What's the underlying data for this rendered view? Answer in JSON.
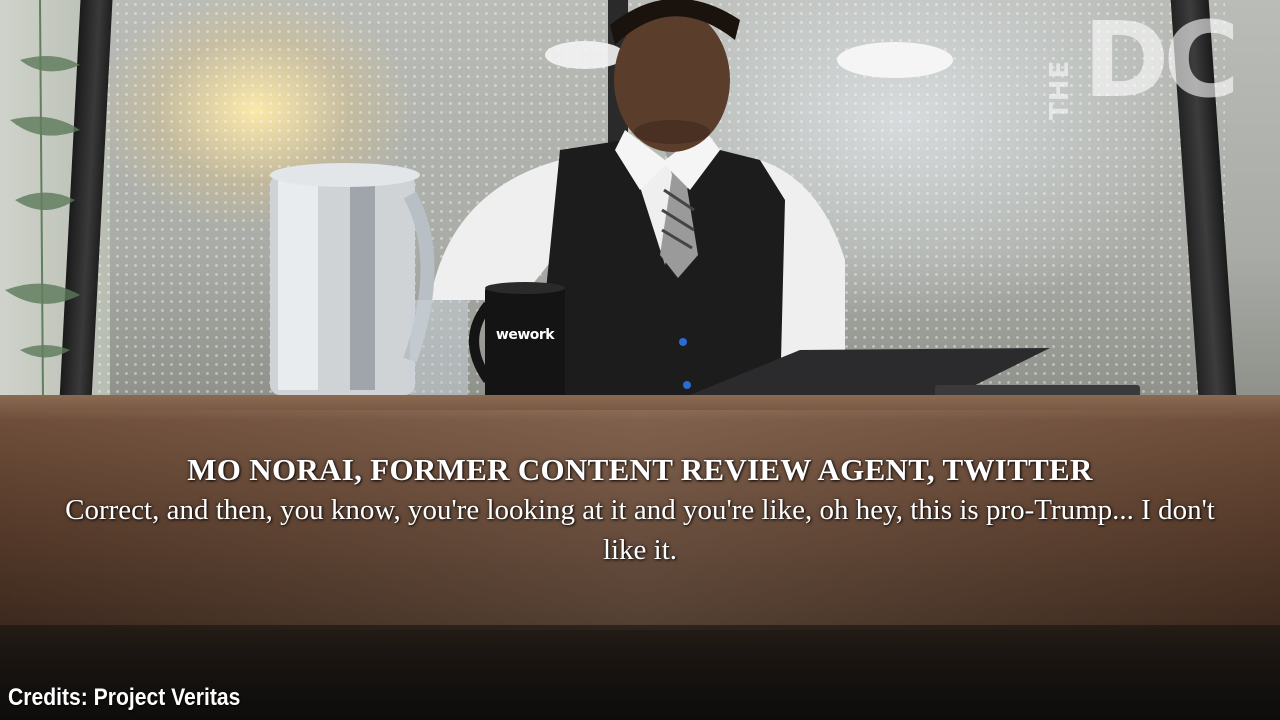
{
  "watermark": {
    "logo_small_text": "THE",
    "logo_large_text": "DC"
  },
  "mug": {
    "brand_text": "wework"
  },
  "caption": {
    "speaker": "MO NORAI, FORMER CONTENT REVIEW AGENT, TWITTER",
    "quote": "Correct, and then, you know, you're looking at it and you're like, oh hey, this is pro-Trump... I don't like it."
  },
  "credits": {
    "text": "Credits: Project Veritas"
  },
  "colors": {
    "caption_text": "#ffffff",
    "vest": "#1c1c1c",
    "shirt": "#f2f2f2",
    "table": "#5a3d2c"
  }
}
